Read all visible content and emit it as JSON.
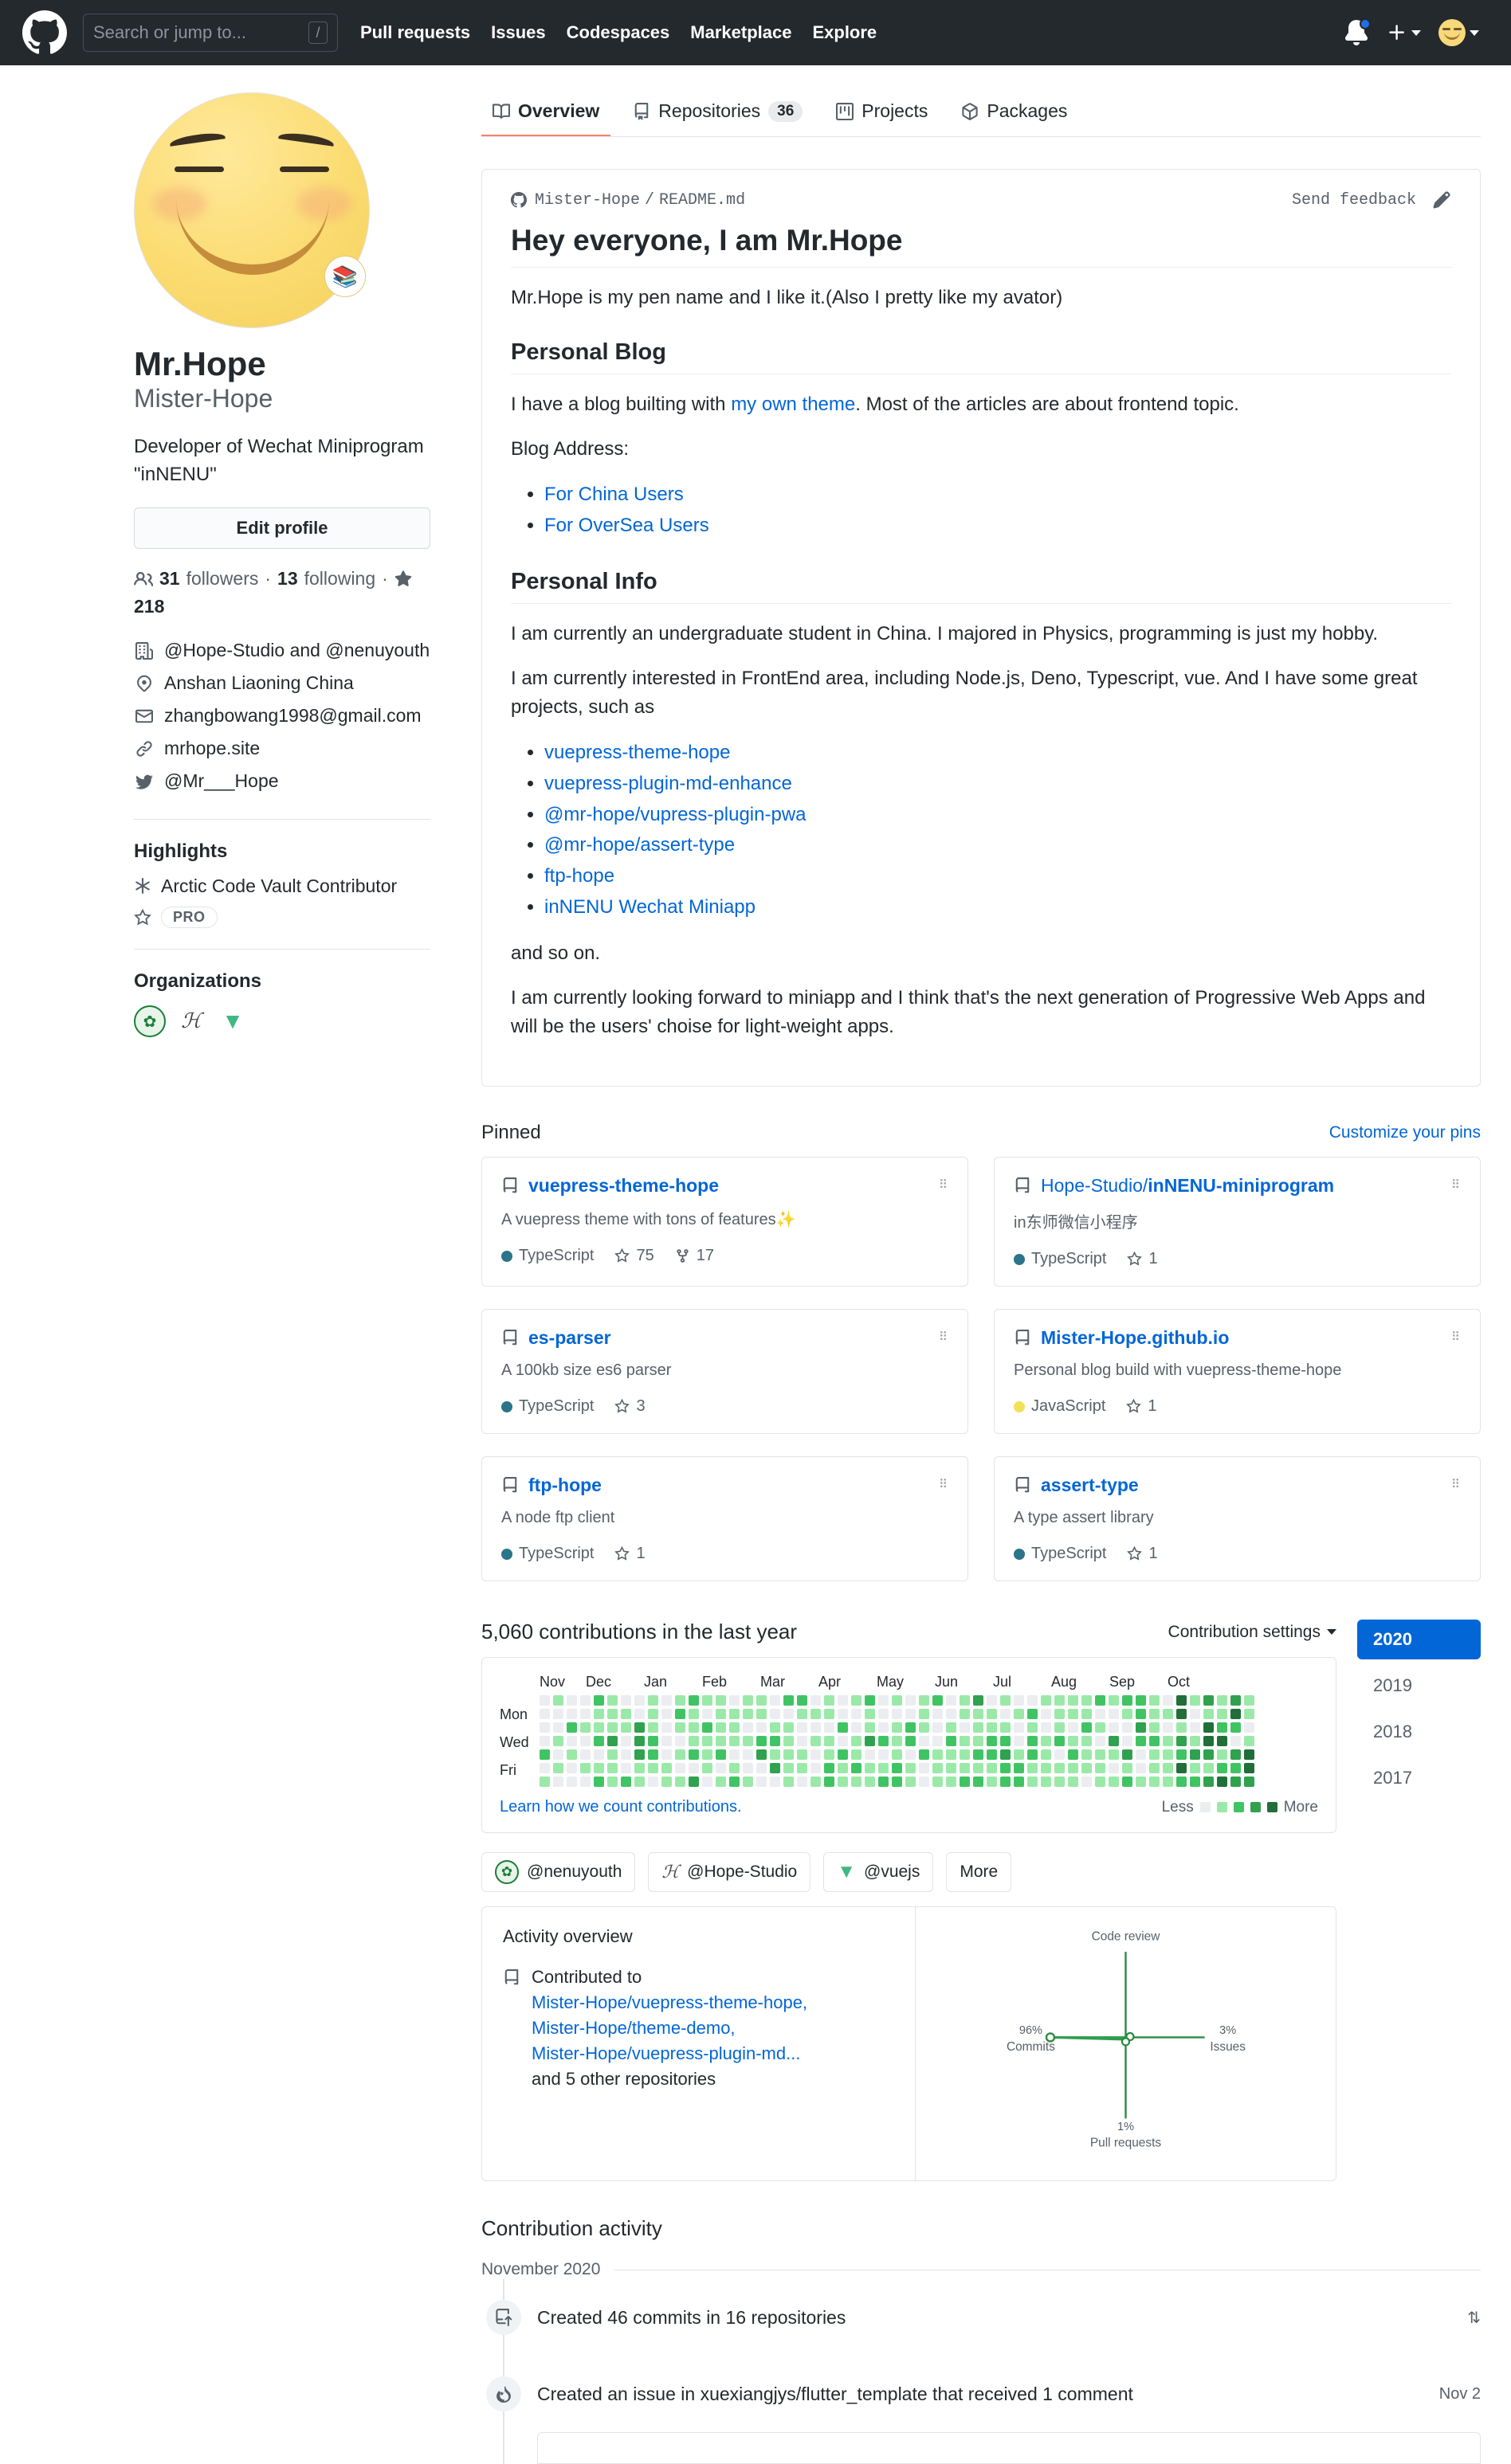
{
  "header": {
    "logo_icon": "github-mark-icon",
    "search": {
      "placeholder": "Search or jump to...",
      "shortcut": "/"
    },
    "nav": [
      {
        "label": "Pull requests"
      },
      {
        "label": "Issues"
      },
      {
        "label": "Codespaces"
      },
      {
        "label": "Marketplace"
      },
      {
        "label": "Explore"
      }
    ],
    "notifications_icon": "bell-icon",
    "create_new_icon": "plus-icon",
    "account_icon": "avatar-icon"
  },
  "profile": {
    "avatar_status_emoji": "📚",
    "name": "Mr.Hope",
    "login": "Mister-Hope",
    "bio": "Developer of Wechat Miniprogram \"inNENU\"",
    "edit_button": "Edit profile",
    "followers_count": "31",
    "followers_label": "followers",
    "following_count": "13",
    "following_label": "following",
    "stars_count": "218",
    "info": [
      {
        "icon": "organization-icon",
        "text": "@Hope-Studio and @nenuyouth"
      },
      {
        "icon": "location-icon",
        "text": "Anshan Liaoning China"
      },
      {
        "icon": "mail-icon",
        "text": "zhangbowang1998@gmail.com"
      },
      {
        "icon": "link-icon",
        "text": "mrhope.site"
      },
      {
        "icon": "twitter-icon",
        "text": "@Mr___Hope"
      }
    ],
    "highlights_title": "Highlights",
    "highlights": [
      {
        "icon": "arctic-vault-icon",
        "text": "Arctic Code Vault Contributor"
      },
      {
        "icon": "star-icon",
        "text": "PRO"
      }
    ],
    "organizations_title": "Organizations",
    "organizations": [
      {
        "name": "nenuyouth",
        "glyph": "✿",
        "color": "#1a7f37",
        "bg": "#e8f3ea"
      },
      {
        "name": "Hope-Studio",
        "glyph": "ℋ",
        "color": "#444",
        "bg": "#ffffff"
      },
      {
        "name": "vuejs",
        "glyph": "▼",
        "color": "#41b883",
        "bg": "#ffffff"
      }
    ]
  },
  "tabs": [
    {
      "label": "Overview",
      "icon": "book-icon",
      "count": null,
      "active": true
    },
    {
      "label": "Repositories",
      "icon": "repo-icon",
      "count": "36",
      "active": false
    },
    {
      "label": "Projects",
      "icon": "project-icon",
      "count": null,
      "active": false
    },
    {
      "label": "Packages",
      "icon": "package-icon",
      "count": null,
      "active": false
    }
  ],
  "readme": {
    "path_owner": "Mister-Hope",
    "path_sep": "/",
    "path_file": "README.md",
    "feedback_label": "Send feedback",
    "edit_icon": "pencil-icon",
    "h1": "Hey everyone, I am Mr.Hope",
    "p1": "Mr.Hope is my pen name and I like it.(Also I pretty like my avator)",
    "h2_blog": "Personal Blog",
    "blog_p_pre": "I have a blog builting with ",
    "blog_link": "my own theme",
    "blog_p_post": ". Most of the articles are about frontend topic.",
    "blog_address_label": "Blog Address:",
    "blog_links": [
      {
        "label": "For China Users"
      },
      {
        "label": "For OverSea Users"
      }
    ],
    "h2_info": "Personal Info",
    "info_p1": "I am currently an undergraduate student in China. I majored in Physics, programming is just my hobby.",
    "info_p2": "I am currently interested in FrontEnd area, including Node.js, Deno, Typescript, vue. And I have some great projects, such as",
    "project_links": [
      {
        "label": "vuepress-theme-hope"
      },
      {
        "label": "vuepress-plugin-md-enhance"
      },
      {
        "label": "@mr-hope/vupress-plugin-pwa"
      },
      {
        "label": "@mr-hope/assert-type"
      },
      {
        "label": "ftp-hope"
      },
      {
        "label": "inNENU Wechat Miniapp"
      }
    ],
    "and_so_on": "and so on.",
    "closing": "I am currently looking forward to miniapp and I think that's the next generation of Progressive Web Apps and will be the users' choise for light-weight apps."
  },
  "pinned": {
    "title": "Pinned",
    "customize_link": "Customize your pins",
    "repos": [
      {
        "owner": "",
        "name": "vuepress-theme-hope",
        "description": "A vuepress theme with tons of features✨",
        "language": "TypeScript",
        "language_color": "#2b7489",
        "stars": "75",
        "forks": "17"
      },
      {
        "owner": "Hope-Studio/",
        "name": "inNENU-miniprogram",
        "description": "in东师微信小程序",
        "language": "TypeScript",
        "language_color": "#2b7489",
        "stars": "1",
        "forks": null
      },
      {
        "owner": "",
        "name": "es-parser",
        "description": "A 100kb size es6 parser",
        "language": "TypeScript",
        "language_color": "#2b7489",
        "stars": "3",
        "forks": null
      },
      {
        "owner": "",
        "name": "Mister-Hope.github.io",
        "description": "Personal blog build with vuepress-theme-hope",
        "language": "JavaScript",
        "language_color": "#f1e05a",
        "stars": "1",
        "forks": null
      },
      {
        "owner": "",
        "name": "ftp-hope",
        "description": "A node ftp client",
        "language": "TypeScript",
        "language_color": "#2b7489",
        "stars": "1",
        "forks": null
      },
      {
        "owner": "",
        "name": "assert-type",
        "description": "A type assert library",
        "language": "TypeScript",
        "language_color": "#2b7489",
        "stars": "1",
        "forks": null
      }
    ]
  },
  "contributions": {
    "heading": "5,060 contributions in the last year",
    "settings_label": "Contribution settings",
    "months": [
      "Nov",
      "Dec",
      "Jan",
      "Feb",
      "Mar",
      "Apr",
      "May",
      "Jun",
      "Jul",
      "Aug",
      "Sep",
      "Oct"
    ],
    "day_labels": [
      "Mon",
      "Wed",
      "Fri"
    ],
    "learn_link": "Learn how we count contributions.",
    "legend_less": "Less",
    "legend_more": "More",
    "legend_colors": [
      "#ebedf0",
      "#9be9a8",
      "#40c463",
      "#30a14e",
      "#216e39"
    ],
    "years": [
      {
        "label": "2020",
        "selected": true
      },
      {
        "label": "2019",
        "selected": false
      },
      {
        "label": "2018",
        "selected": false
      },
      {
        "label": "2017",
        "selected": false
      }
    ],
    "org_filters": [
      {
        "label": "@nenuyouth",
        "glyph": "✿",
        "color": "#1a7f37"
      },
      {
        "label": "@Hope-Studio",
        "glyph": "ℋ",
        "color": "#444"
      },
      {
        "label": "@vuejs",
        "glyph": "▼",
        "color": "#41b883"
      },
      {
        "label": "More",
        "glyph": "",
        "color": "#586069"
      }
    ],
    "activity_overview_title": "Activity overview",
    "contributed_to_label": "Contributed to",
    "contributed_repos": [
      {
        "label": "Mister-Hope/vuepress-theme-hope,"
      },
      {
        "label": "Mister-Hope/theme-demo,"
      },
      {
        "label": "Mister-Hope/vuepress-plugin-md..."
      }
    ],
    "other_repos_label": "and 5 other repositories"
  },
  "chart_data": {
    "type": "radar",
    "title": "Activity overview",
    "categories": [
      "Code review",
      "Issues",
      "Pull requests",
      "Commits"
    ],
    "values": [
      0,
      3,
      1,
      96
    ],
    "labels": [
      "",
      "3%",
      "1%",
      "96%"
    ],
    "unit": "%",
    "axis_color": "#2b8a3e",
    "area_color": "#40c463",
    "legend": "none",
    "grid": false
  },
  "contribution_activity": {
    "title": "Contribution activity",
    "month": "November 2020",
    "items": [
      {
        "icon": "commit-icon",
        "text": "Created 46 commits in 16 repositories",
        "date": "",
        "expandable": true
      },
      {
        "icon": "flame-icon",
        "text": "Created an issue in xuexiangjys/flutter_template that received 1 comment",
        "date": "Nov 2",
        "expandable": false
      }
    ]
  }
}
